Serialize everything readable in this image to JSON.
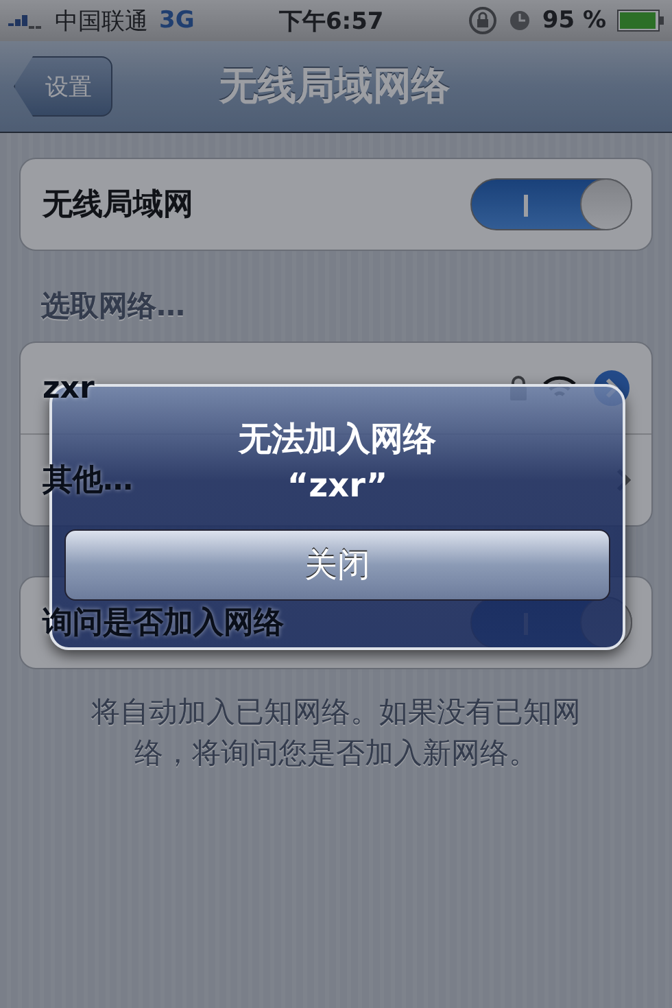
{
  "status_bar": {
    "carrier": "中国联通",
    "network": "3G",
    "time": "下午6:57",
    "battery": "95 %"
  },
  "nav_bar": {
    "back": "设置",
    "title": "无线局域网络"
  },
  "wifi": {
    "label": "无线局域网",
    "on": true
  },
  "section_title": "选取网络…",
  "networks": [
    {
      "kind": "network",
      "name": "zxr",
      "locked": true
    },
    {
      "kind": "other",
      "name": "其他…"
    }
  ],
  "ask": {
    "label": "询问是否加入网络",
    "on": true
  },
  "footnote": "将自动加入已知网络。如果没有已知网络，将询问您是否加入新网络。",
  "alert": {
    "title": "无法加入网络",
    "message": "“zxr”",
    "button": "关闭"
  }
}
